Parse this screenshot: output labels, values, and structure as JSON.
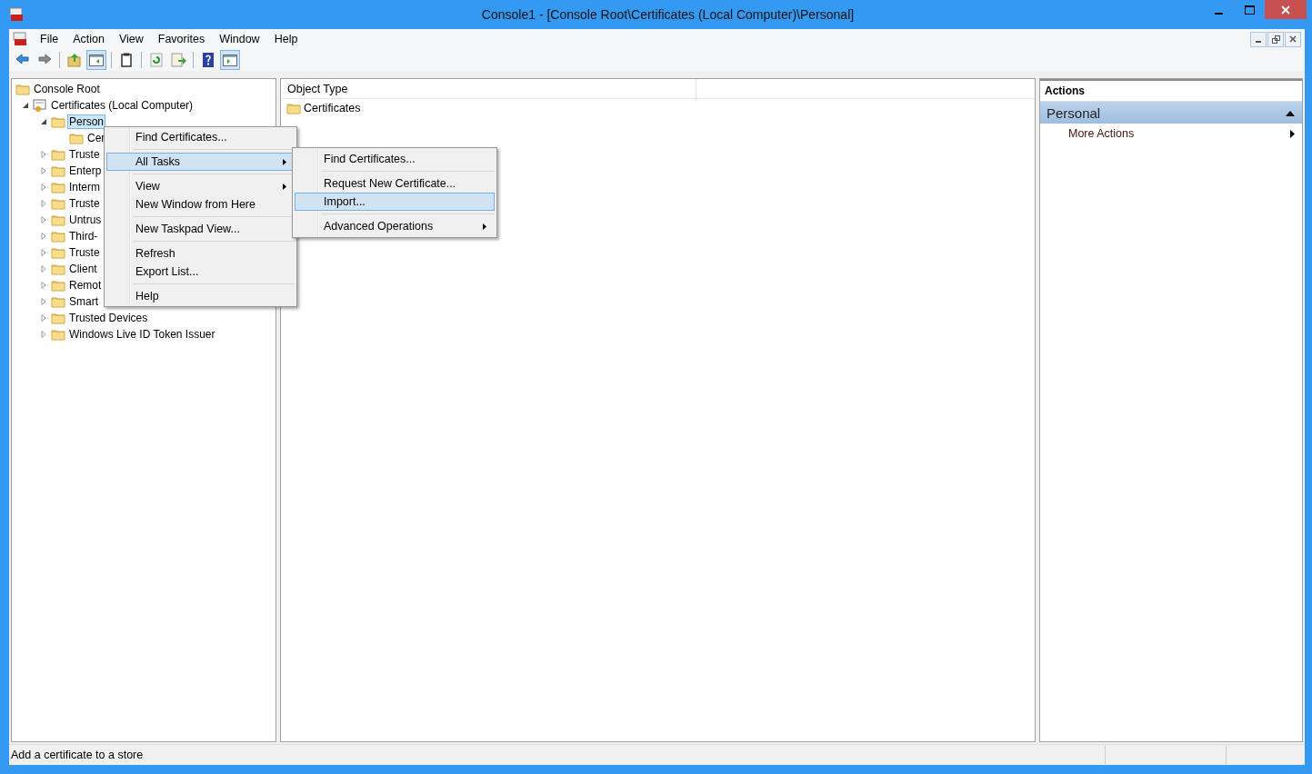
{
  "window": {
    "title": "Console1 - [Console Root\\Certificates (Local Computer)\\Personal]"
  },
  "menu_bar": [
    "File",
    "Action",
    "View",
    "Favorites",
    "Window",
    "Help"
  ],
  "toolbar": [
    {
      "kind": "back"
    },
    {
      "kind": "forward"
    },
    {
      "kind": "sep"
    },
    {
      "kind": "up"
    },
    {
      "kind": "tree",
      "selected": true
    },
    {
      "kind": "sep"
    },
    {
      "kind": "clipboard"
    },
    {
      "kind": "sep"
    },
    {
      "kind": "refresh"
    },
    {
      "kind": "export"
    },
    {
      "kind": "sep"
    },
    {
      "kind": "help"
    },
    {
      "kind": "pane",
      "selected": true
    }
  ],
  "tree": {
    "items": [
      {
        "label": "Console Root",
        "kind": "folder",
        "selected": false,
        "children": [
          {
            "label": "Certificates (Local Computer)",
            "kind": "cert",
            "expanded": true,
            "selected": false,
            "children": [
              {
                "label": "Person",
                "kind": "folder",
                "expanded": true,
                "selected": true,
                "children": [
                  {
                    "label": "Cer",
                    "kind": "folder",
                    "selected": false
                  }
                ]
              },
              {
                "label": "Truste",
                "kind": "folder",
                "expanded": false,
                "selected": false
              },
              {
                "label": "Enterp",
                "kind": "folder",
                "expanded": false,
                "selected": false
              },
              {
                "label": "Interm",
                "kind": "folder",
                "expanded": false,
                "selected": false
              },
              {
                "label": "Truste",
                "kind": "folder",
                "expanded": false,
                "selected": false
              },
              {
                "label": "Untrus",
                "kind": "folder",
                "expanded": false,
                "selected": false
              },
              {
                "label": "Third-",
                "kind": "folder",
                "expanded": false,
                "selected": false
              },
              {
                "label": "Truste",
                "kind": "folder",
                "expanded": false,
                "selected": false
              },
              {
                "label": "Client",
                "kind": "folder",
                "expanded": false,
                "selected": false
              },
              {
                "label": "Remot",
                "kind": "folder",
                "expanded": false,
                "selected": false
              },
              {
                "label": "Smart",
                "kind": "folder",
                "expanded": false,
                "selected": false
              },
              {
                "label": "Trusted Devices",
                "kind": "folder",
                "expanded": false,
                "selected": false
              },
              {
                "label": "Windows Live ID Token Issuer",
                "kind": "folder",
                "expanded": false,
                "selected": false
              }
            ]
          }
        ]
      }
    ]
  },
  "list": {
    "columns": [
      "Object Type"
    ],
    "rows": [
      "Certificates"
    ]
  },
  "actions": {
    "title": "Actions",
    "section": "Personal",
    "items": [
      "More Actions"
    ]
  },
  "context_menu": [
    {
      "kind": "item",
      "label": "Find Certificates...",
      "submenu": false,
      "selected": false
    },
    {
      "kind": "sep"
    },
    {
      "kind": "item",
      "label": "All Tasks",
      "submenu": true,
      "selected": true
    },
    {
      "kind": "sep"
    },
    {
      "kind": "item",
      "label": "View",
      "submenu": true,
      "selected": false
    },
    {
      "kind": "item",
      "label": "New Window from Here",
      "submenu": false,
      "selected": false
    },
    {
      "kind": "sep"
    },
    {
      "kind": "item",
      "label": "New Taskpad View...",
      "submenu": false,
      "selected": false
    },
    {
      "kind": "sep"
    },
    {
      "kind": "item",
      "label": "Refresh",
      "submenu": false,
      "selected": false
    },
    {
      "kind": "item",
      "label": "Export List...",
      "submenu": false,
      "selected": false
    },
    {
      "kind": "sep"
    },
    {
      "kind": "item",
      "label": "Help",
      "submenu": false,
      "selected": false
    }
  ],
  "submenu": [
    {
      "kind": "item",
      "label": "Find Certificates...",
      "submenu": false,
      "selected": false
    },
    {
      "kind": "sep"
    },
    {
      "kind": "item",
      "label": "Request New Certificate...",
      "submenu": false,
      "selected": false
    },
    {
      "kind": "item",
      "label": "Import...",
      "submenu": false,
      "selected": true
    },
    {
      "kind": "sep"
    },
    {
      "kind": "item",
      "label": "Advanced Operations",
      "submenu": true,
      "selected": false
    }
  ],
  "status_bar": "Add a certificate to a store"
}
